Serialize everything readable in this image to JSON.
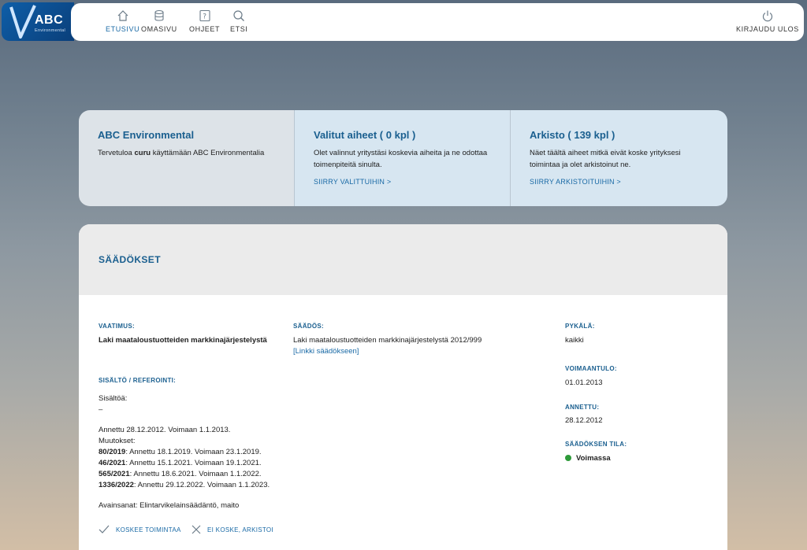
{
  "brand": {
    "name": "ABC",
    "sub": "Environmental"
  },
  "nav": {
    "items": [
      {
        "label": "ETUSIVU",
        "icon": "home-icon"
      },
      {
        "label": "OMASIVU",
        "icon": "database-icon"
      },
      {
        "label": "OHJEET",
        "icon": "help-icon"
      },
      {
        "label": "ETSI",
        "icon": "search-icon"
      }
    ],
    "logout": {
      "label": "KIRJAUDU ULOS",
      "icon": "power-icon"
    }
  },
  "cards": [
    {
      "title": "ABC Environmental",
      "text_pre": "Tervetuloa ",
      "text_bold": "curu",
      "text_post": " käyttämään ABC Environmentalia"
    },
    {
      "title": "Valitut aiheet ( 0 kpl )",
      "text": "Olet valinnut yritystäsi koskevia aiheita ja ne odottaa toimenpiteitä sinulta.",
      "link": "SIIRRY VALITTUIHIN >"
    },
    {
      "title": "Arkisto ( 139 kpl )",
      "text": "Näet täältä aiheet mitkä eivät koske yrityksesi toimintaa ja olet arkistoinut ne.",
      "link": "SIIRRY ARKISTOITUIHIN >"
    }
  ],
  "section": {
    "title": "SÄÄDÖKSET",
    "vaatimus_label": "VAATIMUS:",
    "vaatimus_value": "Laki maataloustuotteiden markkinajärjestelystä",
    "saados_label": "SÄÄDÖS:",
    "saados_value": "Laki maataloustuotteiden markkinajärjestelystä 2012/999",
    "saados_link": "[Linkki säädökseen]",
    "pykala_label": "PYKÄLÄ:",
    "pykala_value": "kaikki",
    "voimaantulo_label": "VOIMAANTULO:",
    "voimaantulo_value": "01.01.2013",
    "annettu_label": "ANNETTU:",
    "annettu_value": "28.12.2012",
    "tila_label": "SÄÄDÖKSEN TILA:",
    "tila_value": "Voimassa",
    "sisalto_label": "SISÄLTÖ / REFEROINTI:",
    "sisaltoa": "Sisältöä:",
    "dash": "–",
    "annettu_line": "Annettu 28.12.2012. Voimaan 1.1.2013.",
    "muutokset": "Muutokset:",
    "changes": [
      {
        "num": "80/2019",
        "text": ": Annettu 18.1.2019. Voimaan 23.1.2019."
      },
      {
        "num": "46/2021",
        "text": ": Annettu 15.1.2021. Voimaan 19.1.2021."
      },
      {
        "num": "565/2021",
        "text": ": Annettu 18.6.2021. Voimaan 1.1.2022."
      },
      {
        "num": "1336/2022",
        "text": ": Annettu 29.12.2022. Voimaan 1.1.2023."
      }
    ],
    "avainsanat": "Avainsanat: Elintarvikelainsäädäntö, maito",
    "action_yes": "KOSKEE TOIMINTAA",
    "action_no": "EI KOSKE, ARKISTOI"
  },
  "colors": {
    "accent": "#1a5f8f",
    "link": "#1a6aa6",
    "status_ok": "#2e9a3a",
    "brand_blue": "#0e5ea8"
  }
}
